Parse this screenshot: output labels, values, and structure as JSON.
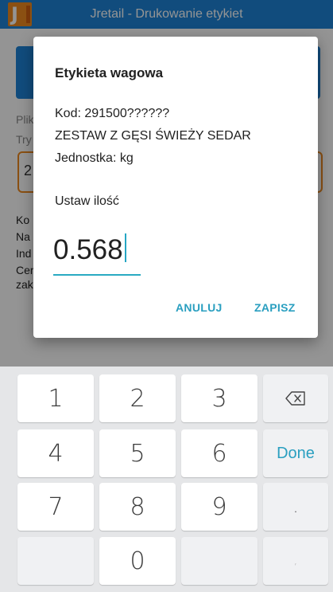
{
  "app": {
    "title": "Jretail - Drukowanie etykiet",
    "logo_letter": "J"
  },
  "background": {
    "labels": [
      "Plik",
      "Try",
      "2",
      "Ko",
      "Na",
      "Ind",
      "Cer",
      "zak"
    ]
  },
  "dialog": {
    "title": "Etykieta wagowa",
    "code_line": "Kod: 291500??????",
    "product_line": "ZESTAW Z GĘSI ŚWIEŻY SEDAR",
    "unit_line": "Jednostka: kg",
    "prompt": "Ustaw ilość",
    "quantity": "0.568",
    "cancel_label": "ANULUJ",
    "save_label": "ZAPISZ"
  },
  "keyboard": {
    "keys": {
      "k1": "1",
      "k2": "2",
      "k3": "3",
      "k4": "4",
      "k5": "5",
      "k6": "6",
      "k7": "7",
      "k8": "8",
      "k9": "9",
      "k0": "0",
      "dot": ".",
      "done": "Done",
      "comma": ","
    },
    "backspace_icon": "backspace-icon"
  },
  "colors": {
    "primary": "#1e84d8",
    "accent": "#2a9fc0",
    "logo": "#f08a20"
  }
}
